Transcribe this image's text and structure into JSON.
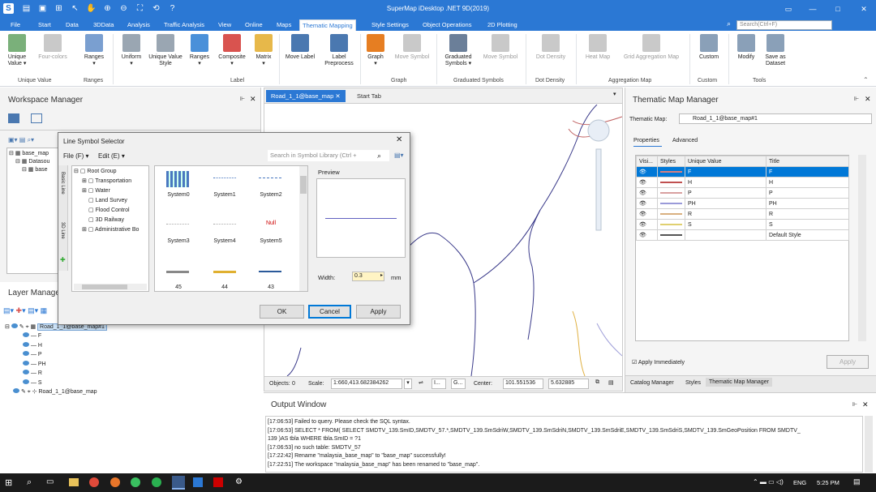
{
  "app": {
    "title": "SuperMap iDesktop .NET 9D(2019)"
  },
  "menu": {
    "tabs": [
      "File",
      "Start",
      "Data",
      "3DData",
      "Analysis",
      "Traffic Analysis",
      "View",
      "Online",
      "Maps",
      "Thematic Mapping",
      "Style Settings",
      "Object Operations",
      "2D Plotting"
    ],
    "active": "Thematic Mapping",
    "search_placeholder": "Search(Ctrl+F)"
  },
  "ribbon": {
    "buttons": [
      {
        "label": "Unique Value",
        "disabled": false,
        "color": "#7ab07a"
      },
      {
        "label": "Four-colors",
        "disabled": true,
        "color": "#c9c9c9"
      },
      {
        "label": "Ranges",
        "disabled": false,
        "color": "#7a9fd0"
      },
      {
        "label": "Uniform",
        "disabled": false,
        "color": "#9aa6b2"
      },
      {
        "label": "Unique Value Style",
        "disabled": false,
        "color": "#9aa6b2"
      },
      {
        "label": "Ranges",
        "disabled": false,
        "color": "#4a90d9"
      },
      {
        "label": "Composite",
        "disabled": false,
        "color": "#d9534f"
      },
      {
        "label": "Matrix",
        "disabled": false,
        "color": "#e7b84a"
      },
      {
        "label": "Move Label",
        "disabled": false,
        "color": "#4a78b0"
      },
      {
        "label": "Label Preprocess",
        "disabled": false,
        "color": "#4a78b0"
      },
      {
        "label": "Graph",
        "disabled": false,
        "color": "#e67e22"
      },
      {
        "label": "Move Symbol",
        "disabled": true,
        "color": "#c9c9c9"
      },
      {
        "label": "Graduated Symbols",
        "disabled": false,
        "color": "#6b7f99"
      },
      {
        "label": "Move Symbol",
        "disabled": true,
        "color": "#c9c9c9"
      },
      {
        "label": "Dot Density",
        "disabled": true,
        "color": "#c9c9c9"
      },
      {
        "label": "Heat Map",
        "disabled": true,
        "color": "#c9c9c9"
      },
      {
        "label": "Grid Aggregation Map",
        "disabled": true,
        "color": "#c9c9c9"
      },
      {
        "label": "Custom",
        "disabled": false,
        "color": "#8aa0b8"
      },
      {
        "label": "Modify",
        "disabled": false,
        "color": "#8aa0b8"
      },
      {
        "label": "Save as Dataset",
        "disabled": false,
        "color": "#8aa0b8"
      }
    ],
    "groups": [
      "Unique Value",
      "Ranges",
      "Label",
      "Graph",
      "Graduated Symbols",
      "Dot Density",
      "Aggregation Map",
      "Custom",
      "Tools"
    ]
  },
  "workspace": {
    "title": "Workspace Manager",
    "tree": [
      "base_map",
      "Datasou",
      "base"
    ]
  },
  "layer_manager": {
    "title": "Layer Manager",
    "layers": [
      "Road_1_1@base_map#1",
      "F",
      "H",
      "P",
      "PH",
      "R",
      "S",
      "Road_1_1@base_map"
    ]
  },
  "map": {
    "tabs": [
      "Road_1_1@base_map",
      "Start Tab"
    ],
    "status": {
      "objects_label": "Objects:",
      "objects_value": "0",
      "scale_label": "Scale:",
      "scale_value": "1:660,413.682384262",
      "center_label": "Center:",
      "center_x": "101.551536",
      "center_y": "5.632885",
      "abbrev1": "I...",
      "abbrev2": "G..."
    }
  },
  "dialog": {
    "title": "Line Symbol Selector",
    "menu": [
      "File (F)",
      "Edit (E)"
    ],
    "search_placeholder": "Search in Symbol Library (Ctrl +",
    "tree": [
      "Root Group",
      "Transportation",
      "Water",
      "Land Survey",
      "Flood Control",
      "3D Railway",
      "Administrative Bo"
    ],
    "side_tabs": [
      "Basic Line",
      "3D Line"
    ],
    "symbols": [
      {
        "label": "System0",
        "style": "dotted-blue"
      },
      {
        "label": "System1",
        "style": "thin-blue"
      },
      {
        "label": "System2",
        "style": "dashed-blue"
      },
      {
        "label": "System3",
        "style": "dotted-light"
      },
      {
        "label": "System4",
        "style": "dotted-light2"
      },
      {
        "label": "System5",
        "style": "null"
      },
      {
        "label": "45",
        "style": "gray-thick"
      },
      {
        "label": "44",
        "style": "yellow-thick"
      },
      {
        "label": "43",
        "style": "blue-thick"
      }
    ],
    "null_text": "Null",
    "preview_label": "Preview",
    "width_label": "Width:",
    "width_value": "0.3",
    "width_unit": "mm",
    "buttons": {
      "ok": "OK",
      "cancel": "Cancel",
      "apply": "Apply"
    }
  },
  "thematic": {
    "title": "Thematic Map Manager",
    "map_label": "Thematic Map:",
    "map_value": "Road_1_1@base_map#1",
    "tabs": [
      "Properties",
      "Advanced"
    ],
    "columns": [
      "Visi...",
      "Styles",
      "Unique Value",
      "Title"
    ],
    "rows": [
      {
        "value": "F",
        "title": "F",
        "color": "#d98080",
        "selected": true
      },
      {
        "value": "H",
        "title": "H",
        "color": "#c05050"
      },
      {
        "value": "P",
        "title": "P",
        "color": "#d9a0a0"
      },
      {
        "value": "PH",
        "title": "PH",
        "color": "#9a9ad9"
      },
      {
        "value": "R",
        "title": "R",
        "color": "#d9b080"
      },
      {
        "value": "S",
        "title": "S",
        "color": "#e0d070"
      },
      {
        "value": "",
        "title": "Default Style",
        "color": "#555555"
      }
    ],
    "apply_immediately": "Apply Immediately",
    "apply_button": "Apply",
    "bottom_tabs": [
      "Catalog Manager",
      "Styles",
      "Thematic Map Manager"
    ]
  },
  "output": {
    "title": "Output Window",
    "lines": [
      "[17:06:53] Failed to query. Please check the SQL syntax.",
      "[17:06:53] SELECT * FROM( SELECT SMDTV_139.SmID,SMDTV_57.*,SMDTV_139.SmSdriW,SMDTV_139.SmSdriN,SMDTV_139.SmSdriE,SMDTV_139.SmSdriS,SMDTV_139.SmGeoPosition  FROM SMDTV_",
      "139 )AS tbla WHERE tbla.SmID = ?1",
      "[17:06:53] no such table: SMDTV_57",
      "[17:22:42] Rename \"malaysia_base_map\" to \"base_map\" successfully!",
      "[17:22:51] The workspace \"malaysia_base_map\" has been renamed to \"base_map\"."
    ]
  },
  "taskbar": {
    "language": "ENG",
    "time": "5:25 PM"
  },
  "colors": {
    "accent": "#2b78d4",
    "selected_row": "#0078d7"
  }
}
